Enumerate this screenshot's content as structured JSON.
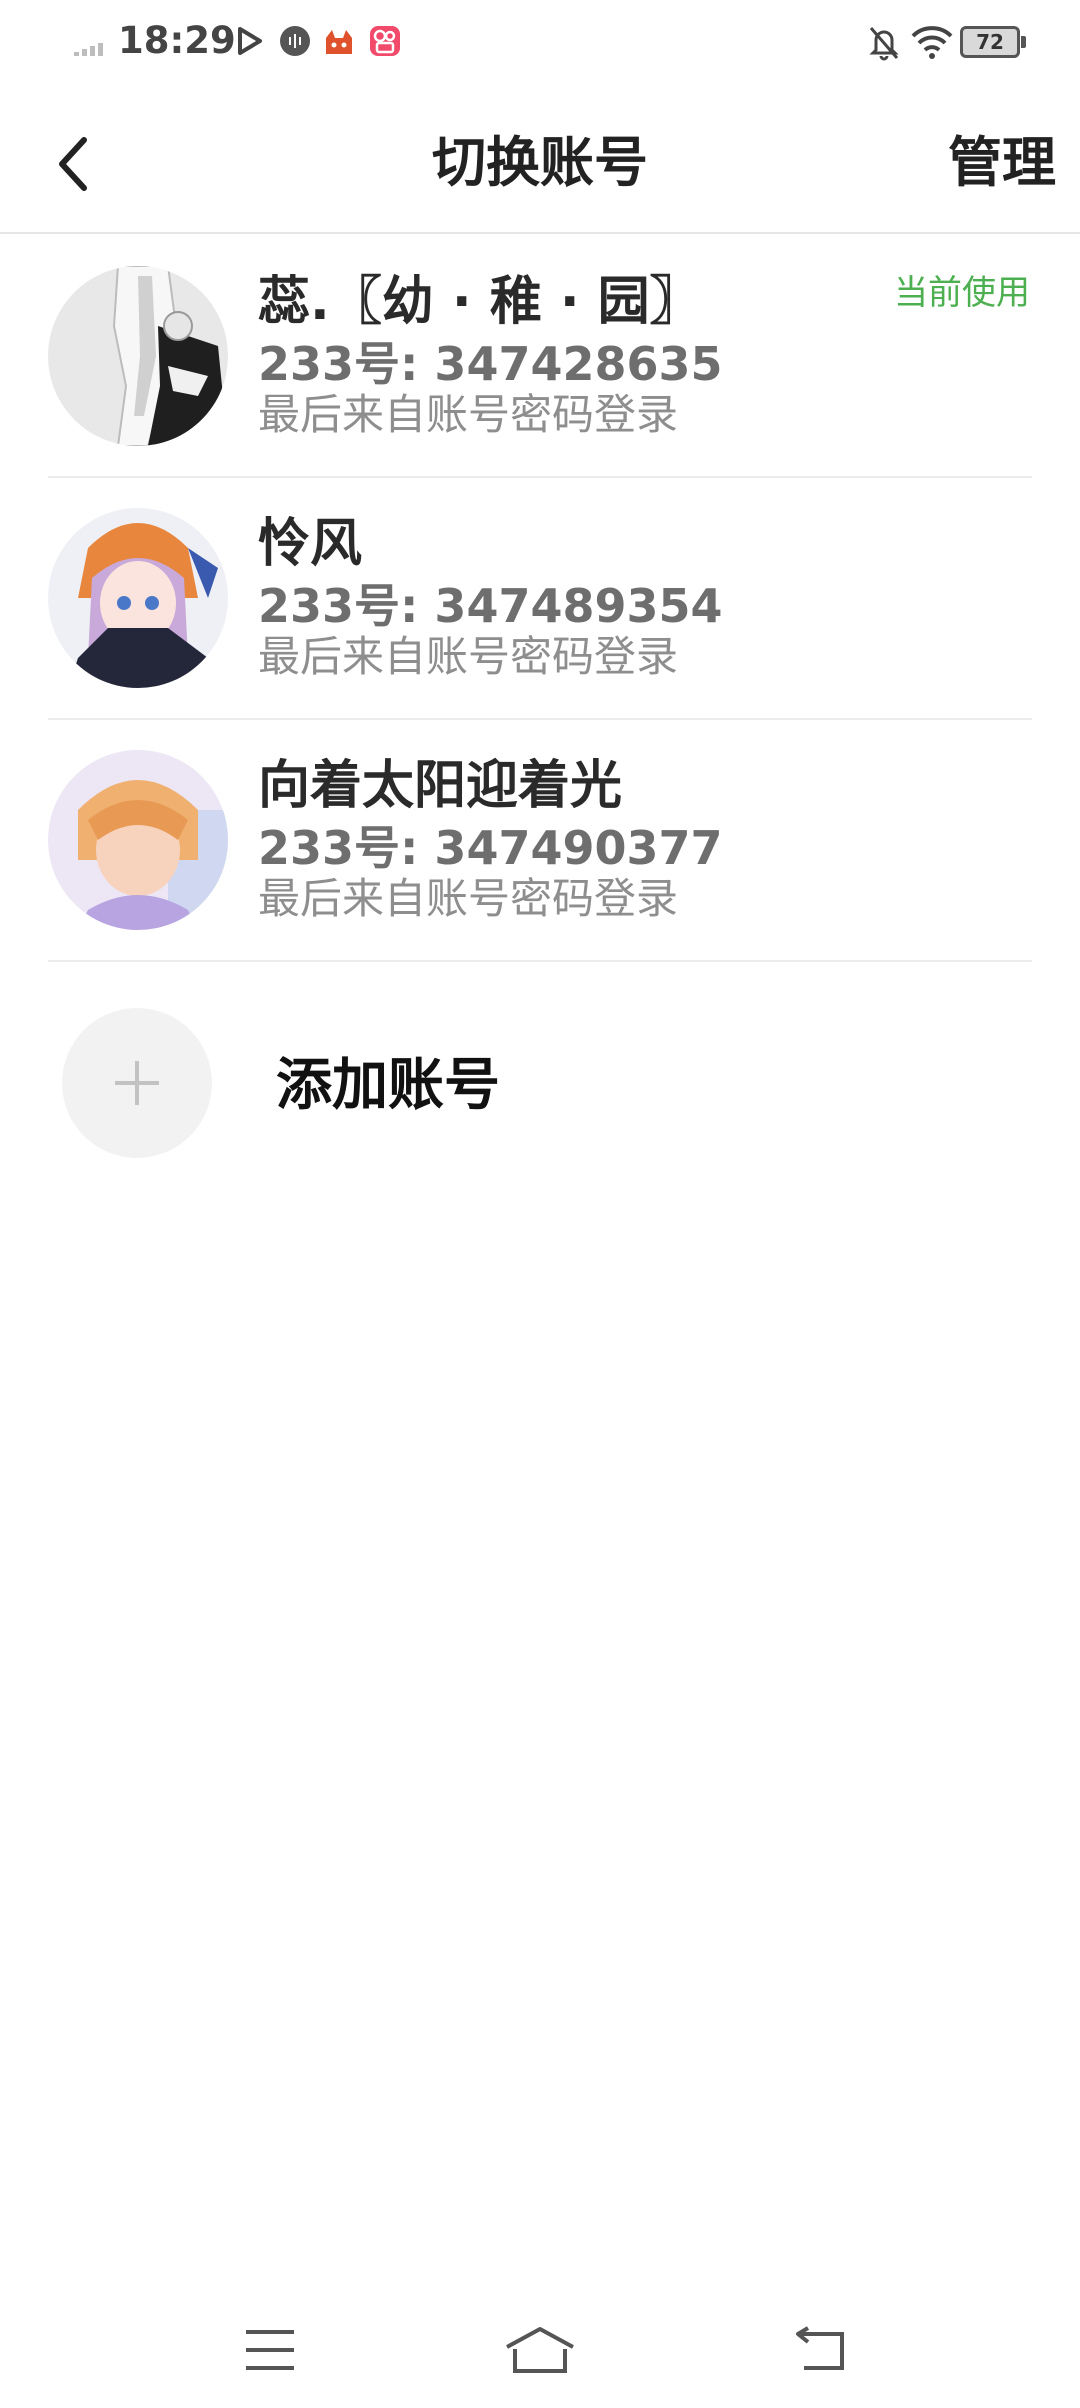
{
  "status_bar": {
    "time": "18:29",
    "battery": "72",
    "icons": [
      "signal-icon",
      "play-icon",
      "voice-icon",
      "fox-app-icon",
      "kuaishou-app-icon",
      "silent-bell-icon",
      "wifi-icon",
      "battery-icon"
    ]
  },
  "header": {
    "title": "切换账号",
    "manage_label": "管理",
    "back_icon": "chevron-left-icon"
  },
  "accounts": [
    {
      "name": "蕊.〖幼 · 稚 · 园〗",
      "id": "233号: 347428635",
      "login": "最后来自账号密码登录",
      "badge": "当前使用"
    },
    {
      "name": "怜风",
      "id": "233号: 347489354",
      "login": "最后来自账号密码登录"
    },
    {
      "name": "向着太阳迎着光",
      "id": "233号: 347490377",
      "login": "最后来自账号密码登录"
    }
  ],
  "add_account": {
    "label": "添加账号",
    "icon": "plus-icon"
  },
  "nav_bar": {
    "icons": [
      "menu-icon",
      "home-icon",
      "back-icon"
    ]
  },
  "colors": {
    "accent_green": "#4caf50",
    "divider": "#ececec",
    "secondary_text": "#6e6e6e",
    "tertiary_text": "#8e8e8e"
  }
}
